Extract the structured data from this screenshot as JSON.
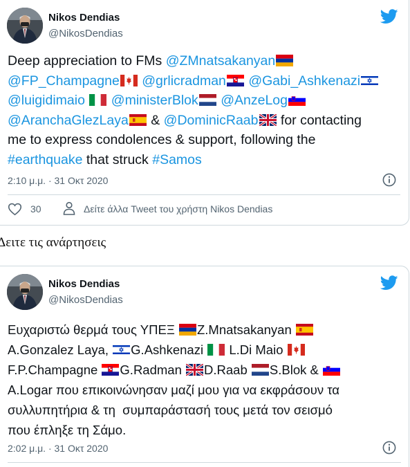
{
  "tweet1": {
    "author_name": "Nikos Dendias",
    "author_handle": "@NikosDendias",
    "lines": {
      "l1_text": "Deep appreciation to FMs ",
      "l1_m1": "@ZMnatsakanyan",
      "l2_m1": "@FP_Champagne",
      "l2_m2": "@grlicradman",
      "l2_m3": "@Gabi_Ashkenazi",
      "l3_m1": "@luigidimaio",
      "l3_m2": "@ministerBlok",
      "l3_m3": "@AnzeLog",
      "l4_m1": "@AranchaGlezLaya",
      "l4_amp": " & ",
      "l4_m2": "@DominicRaab",
      "l4_text": " for contacting",
      "l5_text": "me to express condolences & support, following the",
      "l6_h1": "#earthquake",
      "l6_text": " that struck ",
      "l6_h2": "#Samos"
    },
    "timestamp": "2:10 μ.μ. · 31 Οκτ 2020",
    "like_count": "30",
    "see_more": "Δείτε άλλα Tweet του χρήστη Nikos Dendias"
  },
  "between_text": "Δειτε τις ανάρτησεις",
  "tweet2": {
    "author_name": "Nikos Dendias",
    "author_handle": "@NikosDendias",
    "lines": {
      "l1a": "Ευχαριστώ θερμά τους ΥΠΕΞ ",
      "l1b": "Z.Mnatsakanyan ",
      "l2a": "A.Gonzalez Laya, ",
      "l2b": "G.Ashkenazi ",
      "l2c": "L.Di Maio ",
      "l3a": "F.P.Champagne ",
      "l3b": "G.Radman ",
      "l3c": "D.Raab ",
      "l3d": "S.Blok & ",
      "l4": "A.Logar που επικοινώνησαν μαζί μου για να εκφράσουν τα",
      "l5": "συλλυπητήρια & τη  συμπαράστασή τους μετά τον σεισμό",
      "l6": "που έπληξε τη Σάμο."
    },
    "timestamp": "2:02 μ.μ. · 31 Οκτ 2020"
  },
  "icons": {
    "brand_color": "#1d9bf0",
    "link_color": "#1b95e0",
    "bird": "twitter-bird-icon",
    "info": "info-icon",
    "like": "heart-icon",
    "user": "person-icon"
  }
}
